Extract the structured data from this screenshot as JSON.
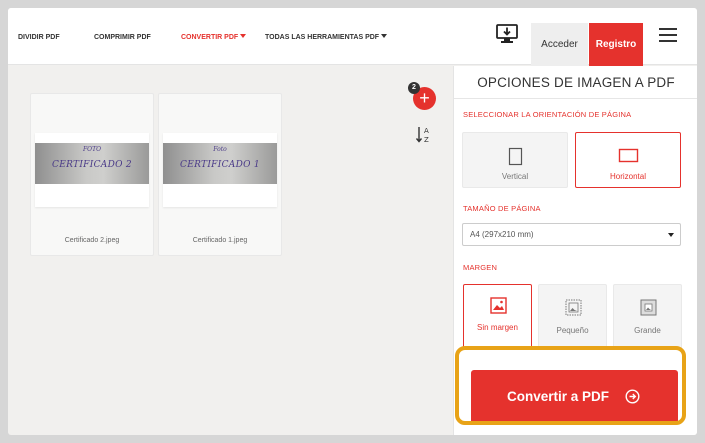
{
  "nav": {
    "links": [
      {
        "label": "DIVIDIR PDF"
      },
      {
        "label": "COMPRIMIR PDF"
      },
      {
        "label": "CONVERTIR PDF"
      },
      {
        "label": "TODAS LAS HERRAMIENTAS PDF"
      }
    ],
    "login_label": "Acceder",
    "register_label": "Registro",
    "desktop_icon": "desktop-download-icon",
    "menu_icon": "hamburger-menu-icon"
  },
  "workspace": {
    "files": [
      {
        "name": "Certificado 2.jpeg",
        "photo_line1": "FOTO",
        "photo_line2": "CERTIFICADO 2"
      },
      {
        "name": "Certificado 1.jpeg",
        "photo_line1": "Foto",
        "photo_line2": "CERTIFICADO 1"
      }
    ],
    "file_count_badge": "2",
    "add_icon": "plus-icon",
    "sort_icon": "sort-az-icon"
  },
  "sidebar": {
    "title": "OPCIONES DE IMAGEN A PDF",
    "orientation_label": "SELECCIONAR LA ORIENTACIÓN DE PÁGINA",
    "orientation_options": [
      {
        "label": "Vertical",
        "selected": false
      },
      {
        "label": "Horizontal",
        "selected": true
      }
    ],
    "page_size_label": "TAMAÑO DE PÁGINA",
    "page_size_value": "A4 (297x210 mm)",
    "margin_label": "MARGEN",
    "margin_options": [
      {
        "label": "Sin margen",
        "selected": true
      },
      {
        "label": "Pequeño",
        "selected": false
      },
      {
        "label": "Grande",
        "selected": false
      }
    ],
    "convert_label": "Convertir a PDF"
  },
  "colors": {
    "accent": "#e5322d",
    "highlight": "#e8a317"
  }
}
